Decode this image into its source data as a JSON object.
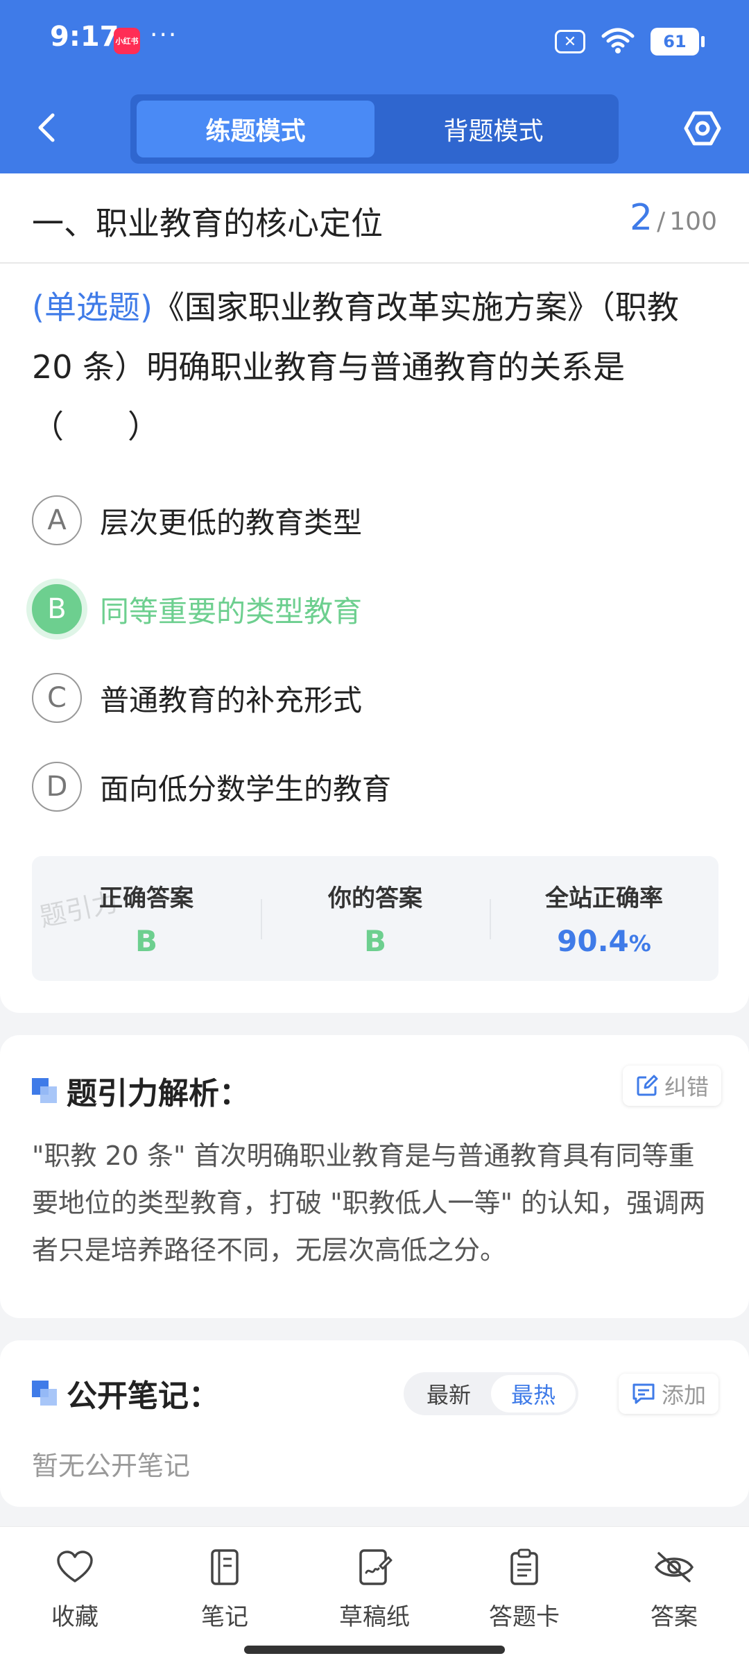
{
  "status": {
    "time": "9:17",
    "app_badge": "小红书",
    "more": "···",
    "sim_icon": "✕",
    "battery": "61"
  },
  "nav": {
    "modes": [
      {
        "label": "练题模式",
        "active": true
      },
      {
        "label": "背题模式",
        "active": false
      }
    ]
  },
  "section": {
    "title": "一、职业教育的核心定位",
    "current": "2",
    "separator": "/",
    "total": "100"
  },
  "question": {
    "type": "(单选题)",
    "text": "《国家职业教育改革实施方案》（职教 20 条）明确职业教育与普通教育的关系是（　　）"
  },
  "options": [
    {
      "letter": "A",
      "text": "层次更低的教育类型"
    },
    {
      "letter": "B",
      "text": "同等重要的类型教育"
    },
    {
      "letter": "C",
      "text": "普通教育的补充形式"
    },
    {
      "letter": "D",
      "text": "面向低分数学生的教育"
    }
  ],
  "answer_box": {
    "watermark": "题引力",
    "correct_label": "正确答案",
    "correct_value": "B",
    "yours_label": "你的答案",
    "yours_value": "B",
    "rate_label": "全站正确率",
    "rate_value": "90.4",
    "rate_unit": "%"
  },
  "analysis": {
    "title": "题引力解析：",
    "report_label": "纠错",
    "text": "\"职教 20 条\" 首次明确职业教育是与普通教育具有同等重要地位的类型教育，打破 \"职教低人一等\" 的认知，强调两者只是培养路径不同，无层次高低之分。"
  },
  "notes": {
    "title": "公开笔记：",
    "sort_latest": "最新",
    "sort_hot": "最热",
    "add_label": "添加",
    "empty": "暂无公开笔记"
  },
  "bottom_bar": [
    {
      "label": "收藏",
      "icon": "heart-icon"
    },
    {
      "label": "笔记",
      "icon": "notebook-icon"
    },
    {
      "label": "草稿纸",
      "icon": "draft-icon"
    },
    {
      "label": "答题卡",
      "icon": "clipboard-icon"
    },
    {
      "label": "答案",
      "icon": "eye-off-icon"
    }
  ],
  "colors": {
    "primary": "#3f7be8",
    "correct": "#6dcf8f"
  }
}
